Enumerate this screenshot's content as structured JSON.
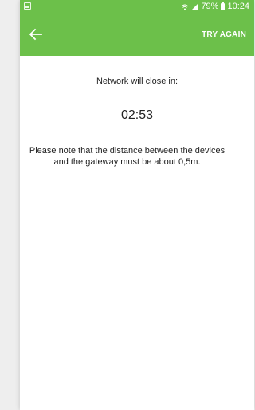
{
  "status_bar": {
    "battery_percent": "79%",
    "time": "10:24",
    "left_icon": "gallery-icon",
    "icons": [
      "wifi-icon",
      "signal-icon",
      "battery-icon"
    ]
  },
  "app_bar": {
    "back_icon": "back-arrow-icon",
    "action_label": "TRY AGAIN"
  },
  "content": {
    "network_label": "Network will close in:",
    "countdown": "02:53",
    "note_line1": "Please note that the distance between the devices",
    "note_line2": "and the gateway must be about 0,5m."
  },
  "colors": {
    "accent": "#6cc04a",
    "text": "#222222",
    "background": "#ffffff"
  }
}
